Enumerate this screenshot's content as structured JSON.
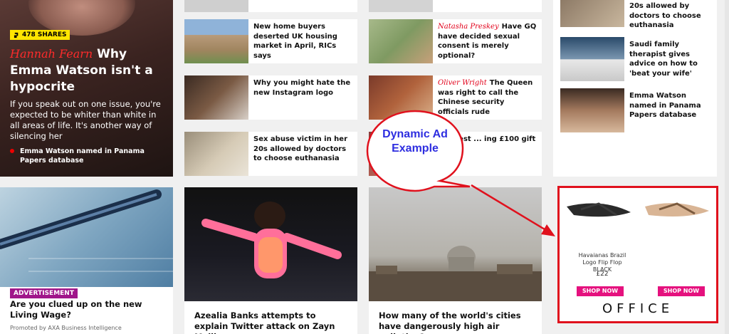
{
  "feature": {
    "shares": "478 SHARES",
    "author": "Hannah Fearn",
    "headline": "Why Emma Watson isn't a hypocrite",
    "standfirst": "If you speak out on one issue, you're expected to be whiter than white in all areas of life. It's another way of silencing her",
    "related": "Emma Watson named in Panama Papers database"
  },
  "col2": [
    {
      "text": "New home buyers deserted UK housing market in April, RICs says"
    },
    {
      "text": "Why you might hate the new Instagram logo"
    },
    {
      "text": "Sex abuse victim in her 20s allowed by doctors to choose euthanasia"
    }
  ],
  "col3": [
    {
      "author": "Natasha Preskey",
      "text": "Have GQ have decided sexual consent is merely optional?"
    },
    {
      "author": "Oliver Wright",
      "text": "The Queen was right to call the Chinese security officials rude"
    },
    {
      "author": "",
      "text": "... guest ... ing £100 gift was ..."
    }
  ],
  "col4": [
    {
      "text": "20s allowed by doctors to choose euthanasia"
    },
    {
      "text": "Saudi family therapist gives advice on how to 'beat your wife'"
    },
    {
      "text": "Emma Watson named in Panama Papers database"
    }
  ],
  "bottom": {
    "ad_tag": "ADVERTISEMENT",
    "ad_title": "Are you clued up on the new Living Wage?",
    "promoted": "Promoted by AXA Business Intelligence",
    "story1": "Azealia Banks attempts to explain Twitter attack on Zayn Malik",
    "story2": "How many of the world's cities have dangerously high air pollution?"
  },
  "dynamic_ad": {
    "product": "Havaianas Brazil Logo Flip Flop BLACK",
    "price": "£22",
    "shop_label": "SHOP NOW",
    "brand": "OFFICE"
  },
  "callout": {
    "text": "Dynamic Ad Example",
    "color": "#2e2ee0",
    "highlight_color": "#e0111d"
  }
}
